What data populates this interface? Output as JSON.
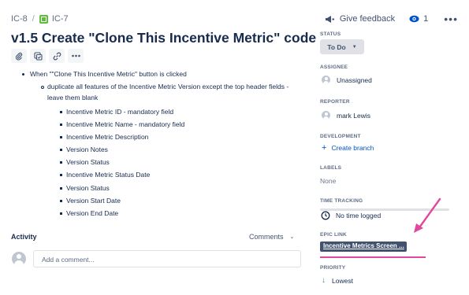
{
  "breadcrumb": {
    "parent": "IC-8",
    "separator": "/",
    "issue": "IC-7"
  },
  "top_actions": {
    "feedback_label": "Give feedback",
    "watchers_count": "1"
  },
  "issue": {
    "title": "v1.5 Create \"Clone This Incentive Metric\" code"
  },
  "description": {
    "bullet": "When \"\"Clone This Incentive Metric\" button is clicked",
    "sub_bullet_line1": "duplicate all features of the Incentive Metric Version except the top header fields -",
    "sub_bullet_line2": "leave them blank",
    "fields": [
      "Incentive Metric ID - mandatory field",
      "Incentive Metric Name - mandatory field",
      "Incentive Metric Description",
      "Version Notes",
      "Version Status",
      "Incentive Metric Status Date",
      "Version Status",
      "Version Start Date",
      "Version End Date"
    ]
  },
  "activity": {
    "label": "Activity",
    "sort_label": "Comments",
    "comment_placeholder": "Add a comment..."
  },
  "sidebar": {
    "status_label": "STATUS",
    "status_value": "To Do",
    "assignee_label": "ASSIGNEE",
    "assignee_value": "Unassigned",
    "reporter_label": "REPORTER",
    "reporter_value": "mark Lewis",
    "development_label": "DEVELOPMENT",
    "create_branch": "Create branch",
    "labels_label": "LABELS",
    "labels_value": "None",
    "time_tracking_label": "TIME TRACKING",
    "time_tracking_value": "No time logged",
    "epic_link_label": "EPIC LINK",
    "epic_link_value": "Incentive Metrics Screen ...",
    "priority_label": "PRIORITY",
    "priority_value": "Lowest"
  },
  "colors": {
    "annotation_arrow": "#e0479e",
    "epic_chip": "#42526e",
    "link": "#0052cc",
    "priority_arrow": "#2a9d3f"
  }
}
